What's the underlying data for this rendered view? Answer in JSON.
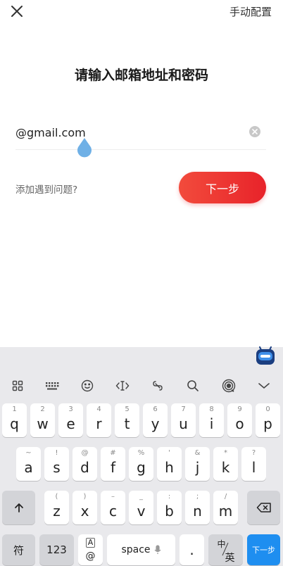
{
  "header": {
    "close_icon": "close-icon",
    "manual_config": "手动配置"
  },
  "form": {
    "title": "请输入邮箱地址和密码",
    "email_value": "@gmail.com",
    "help_link": "添加遇到问题?",
    "next_button": "下一步"
  },
  "keyboard": {
    "rows": [
      [
        {
          "sub": "1",
          "main": "q"
        },
        {
          "sub": "2",
          "main": "w"
        },
        {
          "sub": "3",
          "main": "e"
        },
        {
          "sub": "4",
          "main": "r"
        },
        {
          "sub": "5",
          "main": "t"
        },
        {
          "sub": "6",
          "main": "y"
        },
        {
          "sub": "7",
          "main": "u"
        },
        {
          "sub": "8",
          "main": "i"
        },
        {
          "sub": "9",
          "main": "o"
        },
        {
          "sub": "0",
          "main": "p"
        }
      ],
      [
        {
          "sub": "~",
          "main": "a"
        },
        {
          "sub": "!",
          "main": "s"
        },
        {
          "sub": "@",
          "main": "d"
        },
        {
          "sub": "#",
          "main": "f"
        },
        {
          "sub": "%",
          "main": "g"
        },
        {
          "sub": "'",
          "main": "h"
        },
        {
          "sub": "&",
          "main": "j"
        },
        {
          "sub": "*",
          "main": "k"
        },
        {
          "sub": "?",
          "main": "l"
        }
      ],
      [
        {
          "sub": "(",
          "main": "z"
        },
        {
          "sub": ")",
          "main": "x"
        },
        {
          "sub": "–",
          "main": "c"
        },
        {
          "sub": "_",
          "main": "v"
        },
        {
          "sub": ":",
          "main": "b"
        },
        {
          "sub": ";",
          "main": "n"
        },
        {
          "sub": "/",
          "main": "m"
        }
      ]
    ],
    "bottom": {
      "symbols": "符",
      "numbers": "123",
      "at_top": "A",
      "at_bottom": "@",
      "space": "space",
      "period": ".",
      "lang_top": "中",
      "lang_bottom": "英",
      "next": "下一步"
    },
    "toolbar_icons": [
      "grid-icon",
      "keyboard-icon",
      "emoji-icon",
      "cursor-icon",
      "clip-icon",
      "search-icon",
      "voice-wave-icon",
      "collapse-icon"
    ]
  },
  "colors": {
    "accent": "#e8232a",
    "key_blue": "#1e8ef0",
    "keyboard_bg": "#e9e9ec"
  }
}
